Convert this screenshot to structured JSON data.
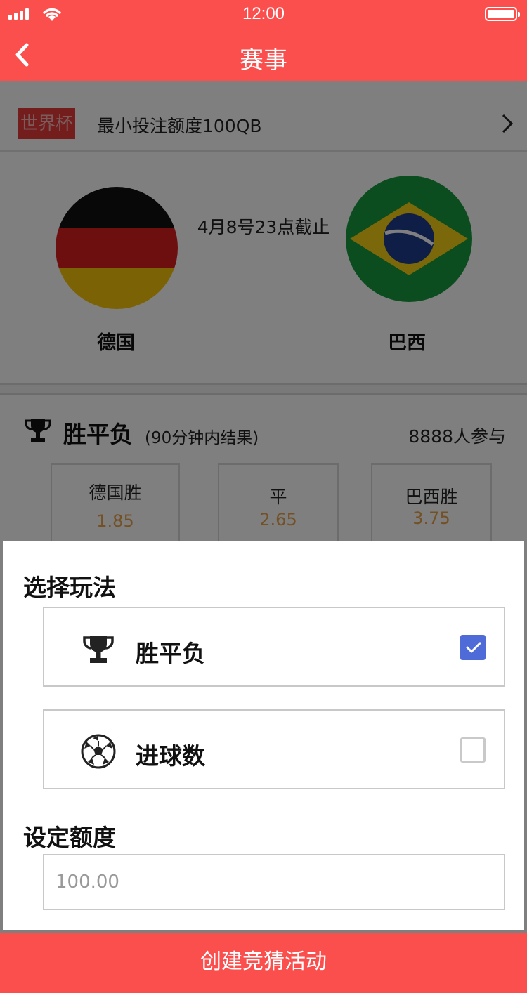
{
  "status_bar": {
    "time": "12:00"
  },
  "nav": {
    "title": "赛事"
  },
  "league": {
    "tag": "世界杯",
    "min_bet": "最小投注额度100QB"
  },
  "match": {
    "deadline": "4月8号23点截止",
    "home_team": "德国",
    "away_team": "巴西"
  },
  "bet": {
    "title": "胜平负",
    "subtitle": "(90分钟内结果)",
    "participants": "8888人参与",
    "odds": [
      {
        "label": "德国胜",
        "value": "1.85"
      },
      {
        "label": "平",
        "value": "2.65"
      },
      {
        "label": "巴西胜",
        "value": "3.75"
      }
    ]
  },
  "sheet": {
    "title": "选择玩法",
    "options": [
      {
        "label": "胜平负",
        "icon": "trophy-icon",
        "checked": true
      },
      {
        "label": "进球数",
        "icon": "soccer-ball-icon",
        "checked": false
      }
    ],
    "amount_title": "设定额度",
    "amount_placeholder": "100.00"
  },
  "create_button": "创建竞猜活动",
  "colors": {
    "brand_red": "#fb4f4e",
    "checkbox_blue": "#4f6bd8",
    "odds_orange": "#e8a04a"
  }
}
